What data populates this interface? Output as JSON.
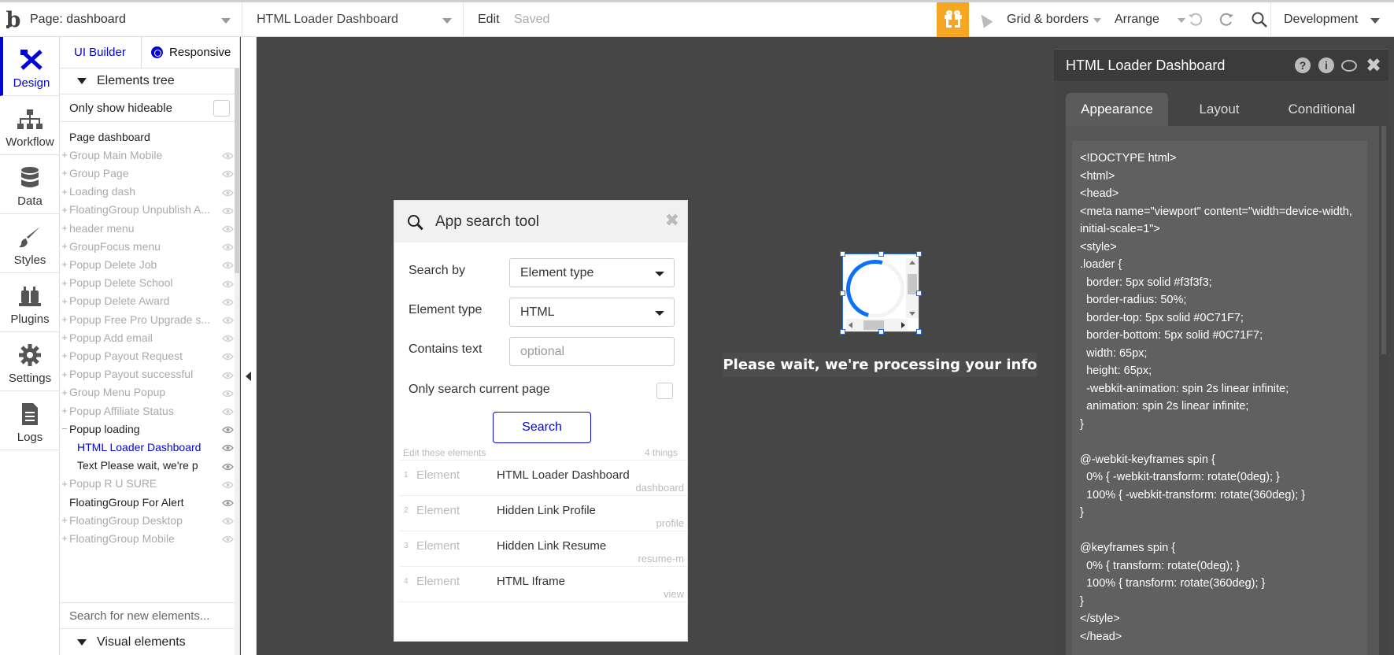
{
  "topbar": {
    "logo": "b",
    "page_select": "Page: dashboard",
    "element_select": "HTML Loader Dashboard",
    "edit": "Edit",
    "saved": "Saved",
    "grid_borders": "Grid & borders",
    "arrange": "Arrange",
    "environment": "Development"
  },
  "rail": [
    {
      "label": "Design",
      "icon": "design-icon"
    },
    {
      "label": "Workflow",
      "icon": "workflow-icon"
    },
    {
      "label": "Data",
      "icon": "database-icon"
    },
    {
      "label": "Styles",
      "icon": "brush-icon"
    },
    {
      "label": "Plugins",
      "icon": "plug-icon"
    },
    {
      "label": "Settings",
      "icon": "gear-icon"
    },
    {
      "label": "Logs",
      "icon": "document-icon"
    }
  ],
  "panel": {
    "tab_ui": "UI Builder",
    "tab_responsive": "Responsive",
    "elements_tree": "Elements tree",
    "only_show_hideable": "Only show hideable",
    "tree": [
      {
        "label": "Page dashboard",
        "plus": "",
        "state": "visible"
      },
      {
        "label": "Group Main Mobile",
        "plus": "+",
        "state": "hidden"
      },
      {
        "label": "Group Page",
        "plus": "+",
        "state": "hidden"
      },
      {
        "label": "Loading dash",
        "plus": "+",
        "state": "hidden"
      },
      {
        "label": "FloatingGroup Unpublish A...",
        "plus": "+",
        "state": "hidden"
      },
      {
        "label": "header menu",
        "plus": "+",
        "state": "hidden"
      },
      {
        "label": "GroupFocus menu",
        "plus": "+",
        "state": "hidden"
      },
      {
        "label": "Popup Delete Job",
        "plus": "+",
        "state": "hidden"
      },
      {
        "label": "Popup Delete School",
        "plus": "+",
        "state": "hidden"
      },
      {
        "label": "Popup Delete Award",
        "plus": "+",
        "state": "hidden"
      },
      {
        "label": "Popup Free Pro Upgrade s...",
        "plus": "+",
        "state": "hidden"
      },
      {
        "label": "Popup Add email",
        "plus": "+",
        "state": "hidden"
      },
      {
        "label": "Popup Payout Request",
        "plus": "+",
        "state": "hidden"
      },
      {
        "label": "Popup Payout successful",
        "plus": "+",
        "state": "hidden"
      },
      {
        "label": "Group Menu Popup",
        "plus": "+",
        "state": "hidden"
      },
      {
        "label": "Popup Affiliate Status",
        "plus": "+",
        "state": "hidden"
      },
      {
        "label": "Popup loading",
        "plus": "−",
        "state": "visible"
      },
      {
        "label": "HTML Loader Dashboard",
        "plus": "",
        "state": "selected"
      },
      {
        "label": "Text Please wait, we're p",
        "plus": "",
        "state": "visible"
      },
      {
        "label": "Popup R U SURE",
        "plus": "+",
        "state": "hidden"
      },
      {
        "label": "FloatingGroup For Alert",
        "plus": "",
        "state": "visible"
      },
      {
        "label": "FloatingGroup Desktop",
        "plus": "+",
        "state": "hidden"
      },
      {
        "label": "FloatingGroup Mobile",
        "plus": "+",
        "state": "hidden"
      }
    ],
    "search_new": "Search for new elements...",
    "visual_elements": "Visual elements"
  },
  "canvas": {
    "wait_text": "Please wait, we're processing your info"
  },
  "search_tool": {
    "title": "App search tool",
    "search_by_label": "Search by",
    "search_by_value": "Element type",
    "element_type_label": "Element type",
    "element_type_value": "HTML",
    "contains_text_label": "Contains text",
    "contains_text_placeholder": "optional",
    "only_current_page_label": "Only search current page",
    "search_button": "Search",
    "edit_hint": "Edit these elements",
    "count": "4 things",
    "results": [
      {
        "num": "1",
        "kind": "Element",
        "name": "HTML Loader Dashboard",
        "page": "dashboard"
      },
      {
        "num": "2",
        "kind": "Element",
        "name": "Hidden Link Profile",
        "page": "profile"
      },
      {
        "num": "3",
        "kind": "Element",
        "name": "Hidden Link Resume",
        "page": "resume-m"
      },
      {
        "num": "4",
        "kind": "Element",
        "name": "HTML Iframe",
        "page": "view"
      }
    ]
  },
  "property_editor": {
    "title": "HTML Loader Dashboard",
    "tabs": [
      "Appearance",
      "Layout",
      "Conditional"
    ],
    "code": "<!DOCTYPE html>\n<html>\n<head>\n<meta name=\"viewport\" content=\"width=device-width, initial-scale=1\">\n<style>\n.loader {\n  border: 5px solid #f3f3f3;\n  border-radius: 50%;\n  border-top: 5px solid #0C71F7;\n  border-bottom: 5px solid #0C71F7;\n  width: 65px;\n  height: 65px;\n  -webkit-animation: spin 2s linear infinite;\n  animation: spin 2s linear infinite;\n}\n\n@-webkit-keyframes spin {\n  0% { -webkit-transform: rotate(0deg); }\n  100% { -webkit-transform: rotate(360deg); }\n}\n\n@keyframes spin {\n  0% { transform: rotate(0deg); }\n  100% { transform: rotate(360deg); }\n}\n</style>\n</head>"
  },
  "colors": {
    "accent": "#0205d3",
    "canvas": "#464646",
    "gift": "#f5a623",
    "loader_blue": "#0C71F7"
  }
}
